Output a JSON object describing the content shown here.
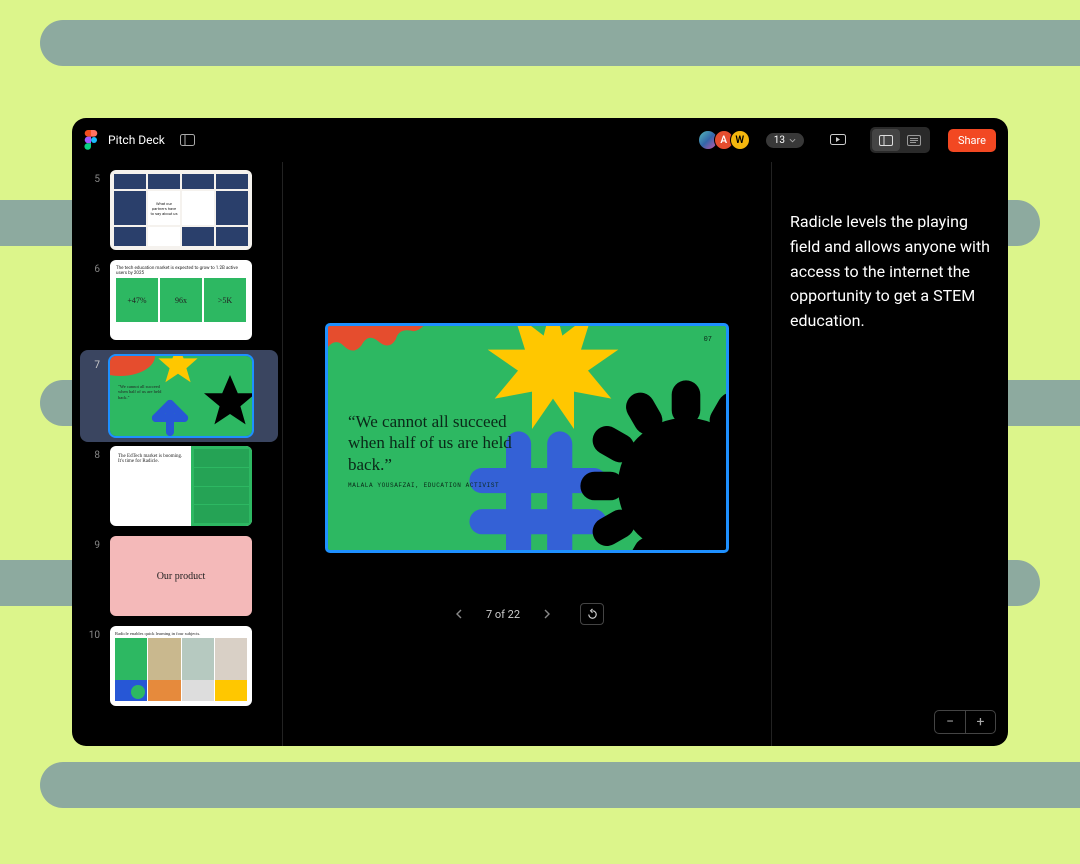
{
  "toolbar": {
    "title": "Pitch Deck",
    "avatars": [
      {
        "label": ""
      },
      {
        "label": "A"
      },
      {
        "label": "W"
      }
    ],
    "more_count": "13",
    "share_label": "Share"
  },
  "thumbnails": [
    {
      "num": "5",
      "title": "What our partners have to say about us"
    },
    {
      "num": "6",
      "headline": "The tech education market is expected to grow to 1.2B active users by 2025",
      "cells": [
        "+47%",
        "96x",
        ">5K"
      ]
    },
    {
      "num": "7",
      "quote": "\"We cannot all succeed when half of us are held back.\""
    },
    {
      "num": "8",
      "text": "The EdTech market is booming. It's time for Radicle."
    },
    {
      "num": "9",
      "title": "Our product"
    },
    {
      "num": "10",
      "title": "Radicle enables quick learning in four subjects."
    }
  ],
  "slide": {
    "number": "07",
    "quote": "“We cannot all succeed when half of us are held back.”",
    "attribution": "MALALA YOUSAFZAI, EDUCATION ACTIVIST"
  },
  "pager": {
    "label": "7 of 22"
  },
  "notes": {
    "text": "Radicle levels the playing field and allows anyone with access to the internet the opportunity to get a STEM education."
  },
  "colors": {
    "accent": "#f24822",
    "slide_bg": "#2db862",
    "selection": "#1e90ff"
  }
}
